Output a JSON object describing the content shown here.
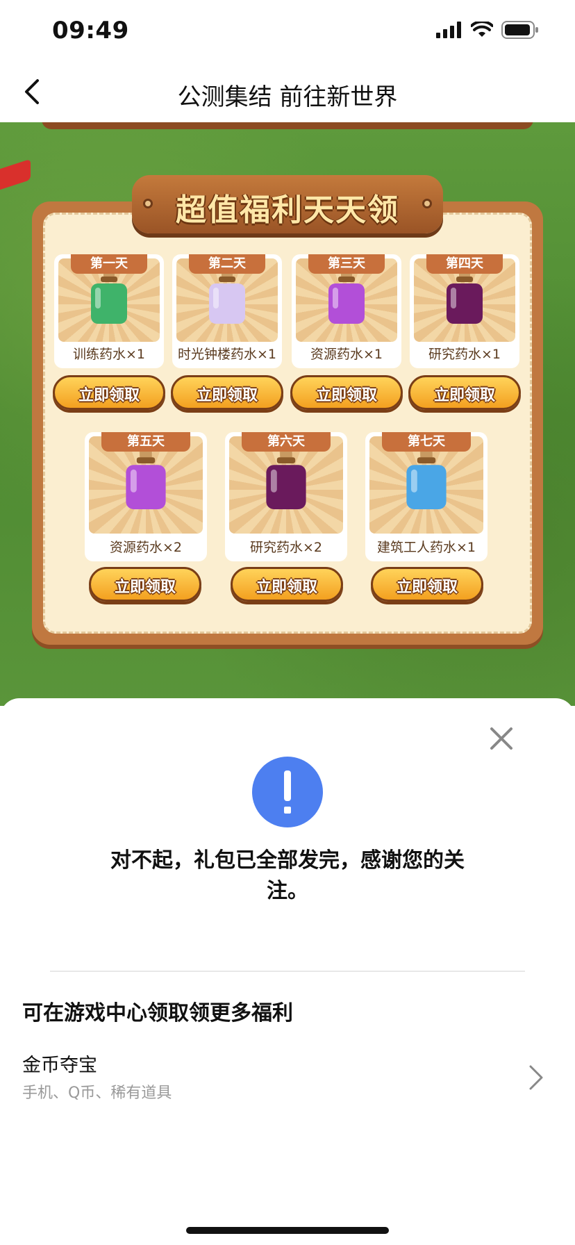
{
  "status_bar": {
    "time": "09:49",
    "icons": [
      "signal-icon",
      "wifi-icon",
      "battery-icon"
    ]
  },
  "nav": {
    "title": "公测集结 前往新世界",
    "back_icon": "chevron-left-icon"
  },
  "banner": {
    "title": "超值福利天天领",
    "claim_label": "立即领取",
    "rewards": [
      {
        "day": "第一天",
        "name": "训练药水×1",
        "color": "#3fb36a"
      },
      {
        "day": "第二天",
        "name": "时光钟楼药水×1",
        "color": "#d7c7f2"
      },
      {
        "day": "第三天",
        "name": "资源药水×1",
        "color": "#b24fd8"
      },
      {
        "day": "第四天",
        "name": "研究药水×1",
        "color": "#6a1a5c"
      },
      {
        "day": "第五天",
        "name": "资源药水×2",
        "color": "#b24fd8"
      },
      {
        "day": "第六天",
        "name": "研究药水×2",
        "color": "#6a1a5c"
      },
      {
        "day": "第七天",
        "name": "建筑工人药水×1",
        "color": "#4aa6e6"
      }
    ]
  },
  "sheet": {
    "message": "对不起，礼包已全部发完，感谢您的关注。",
    "section_title": "可在游戏中心领取领更多福利",
    "item": {
      "title": "金币夺宝",
      "subtitle": "手机、Q币、稀有道具"
    },
    "alert_color": "#4d7ff0"
  }
}
